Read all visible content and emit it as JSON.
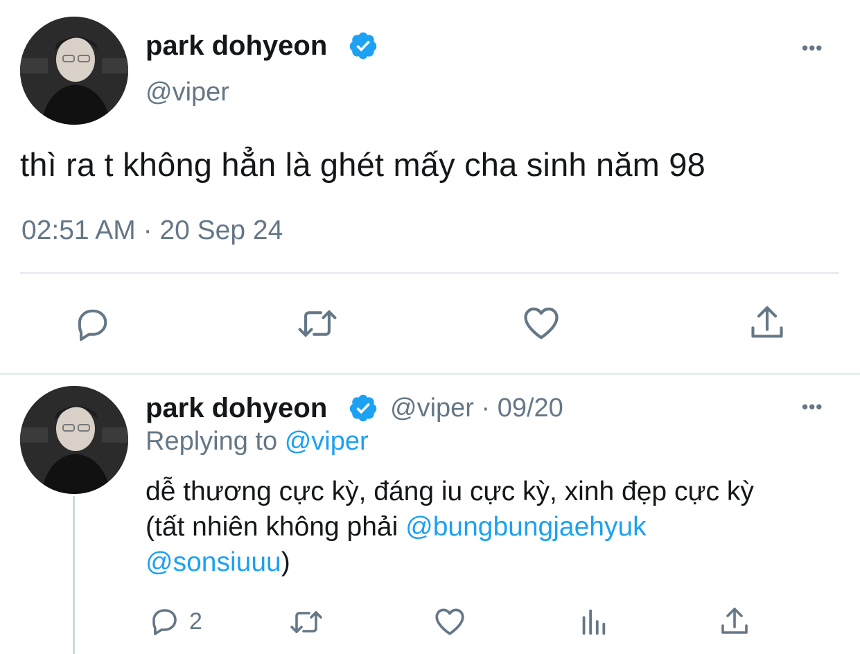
{
  "main_tweet": {
    "author_name": "park dohyeon",
    "author_handle": "@viper",
    "text": "thì ra t không hẳn là ghét mấy cha sinh năm 98",
    "timestamp": "02:51 AM · 20 Sep 24",
    "more": "•••"
  },
  "reply_tweet": {
    "author_name": "park dohyeon",
    "author_handle": "@viper",
    "date": "· 09/20",
    "replying_label": "Replying to",
    "replying_to": "@viper",
    "text_part1": "dễ thương cực kỳ, đáng iu cực kỳ, xinh đẹp cực kỳ",
    "text_part2": "(tất nhiên không phải ",
    "mention1": "@bungbungjaehyuk",
    "mention2": "@sonsiuuu",
    "text_part3": ")",
    "reply_count": "2",
    "more": "•••"
  },
  "icons": {
    "verified": "verified-badge-icon",
    "reply": "reply-icon",
    "retweet": "retweet-icon",
    "like": "like-icon",
    "share": "share-icon",
    "analytics": "analytics-icon"
  },
  "colors": {
    "accent": "#1da1f2",
    "secondary_text": "#657786",
    "divider": "#e1e8ed"
  }
}
